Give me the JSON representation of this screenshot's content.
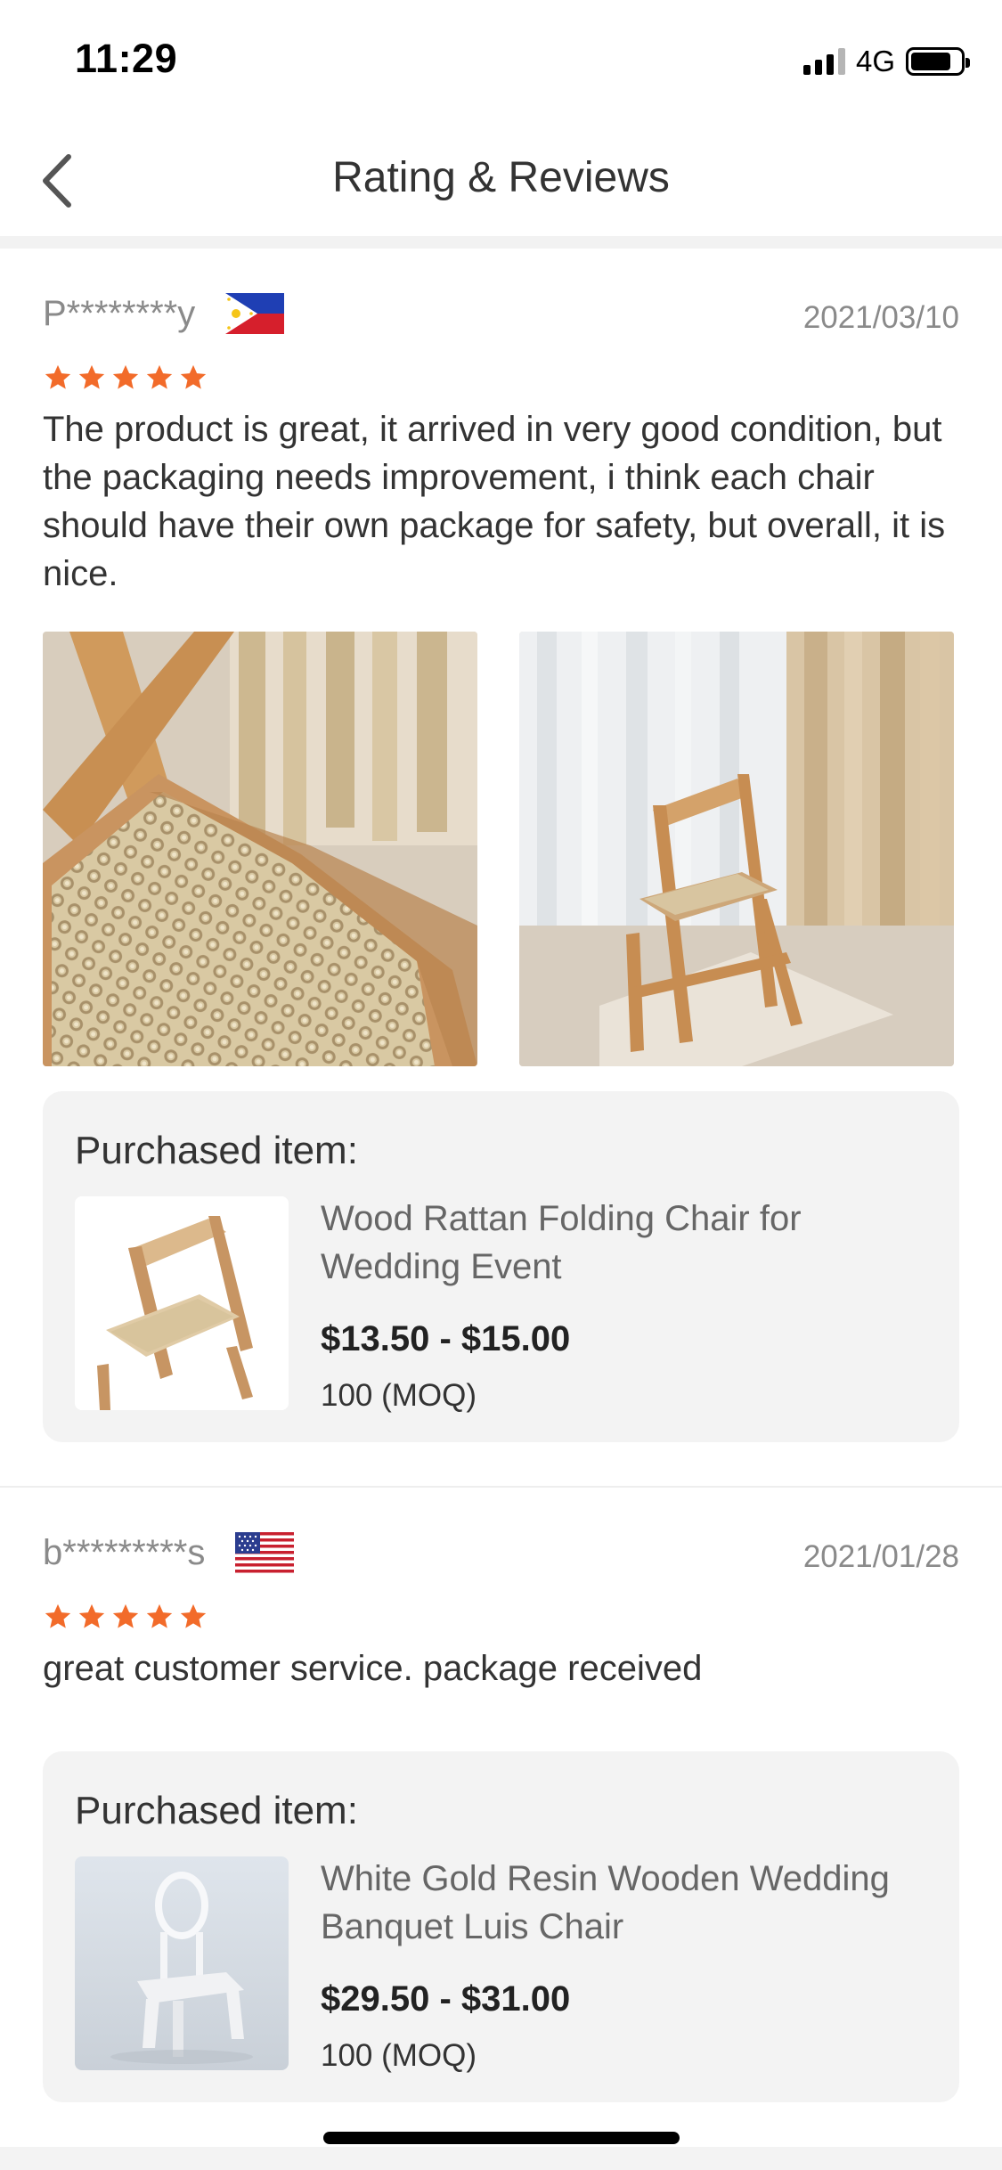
{
  "status_bar": {
    "time": "11:29",
    "network": "4G"
  },
  "navbar": {
    "title": "Rating & Reviews",
    "back_icon": "chevron-left-icon"
  },
  "colors": {
    "star": "#f26b2a",
    "card_bg": "#f3f3f3",
    "muted_text": "#8a8a8a"
  },
  "reviews": [
    {
      "reviewer": "P********y",
      "flag": "philippines-flag-icon",
      "date": "2021/03/10",
      "rating": 5,
      "text": "The product is great, it arrived in very good condition, but the packaging needs improvement, i think each chair should have their own package for safety, but overall, it is nice.",
      "photo_count": 2,
      "purchased": {
        "label": "Purchased item:",
        "name": "Wood Rattan Folding Chair for Wedding Event",
        "price": "$13.50 - $15.00",
        "moq": "100 (MOQ)"
      }
    },
    {
      "reviewer": "b*********s",
      "flag": "usa-flag-icon",
      "date": "2021/01/28",
      "rating": 5,
      "text": "great customer service. package received",
      "purchased": {
        "label": "Purchased item:",
        "name": "White Gold Resin Wooden Wedding Banquet Luis Chair",
        "price": "$29.50 - $31.00",
        "moq": "100 (MOQ)"
      }
    }
  ]
}
